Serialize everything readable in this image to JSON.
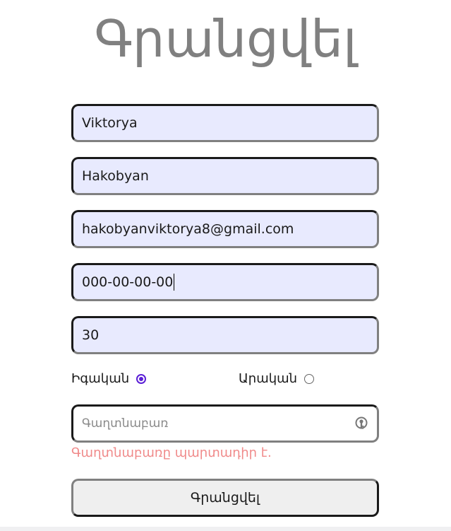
{
  "title": "Գրանցվել",
  "fields": {
    "first_name": "Viktorya",
    "last_name": "Hakobyan",
    "email": "hakobyanviktorya8@gmail.com",
    "phone": "000-00-00-00",
    "age": "30"
  },
  "gender": {
    "male_label": "Իգական",
    "female_label": "Արական",
    "selected": "Իգական"
  },
  "password": {
    "placeholder": "Գաղտնաբառ",
    "value": ""
  },
  "error": "Գաղտնաբառը պարտադիր է.",
  "submit_label": "Գրանցվել",
  "colors": {
    "field_bg": "#e8eafe",
    "accent": "#5b1fd6",
    "error": "#f08a8a",
    "title": "#808080"
  },
  "icons": {
    "password_toggle": "key-icon"
  }
}
